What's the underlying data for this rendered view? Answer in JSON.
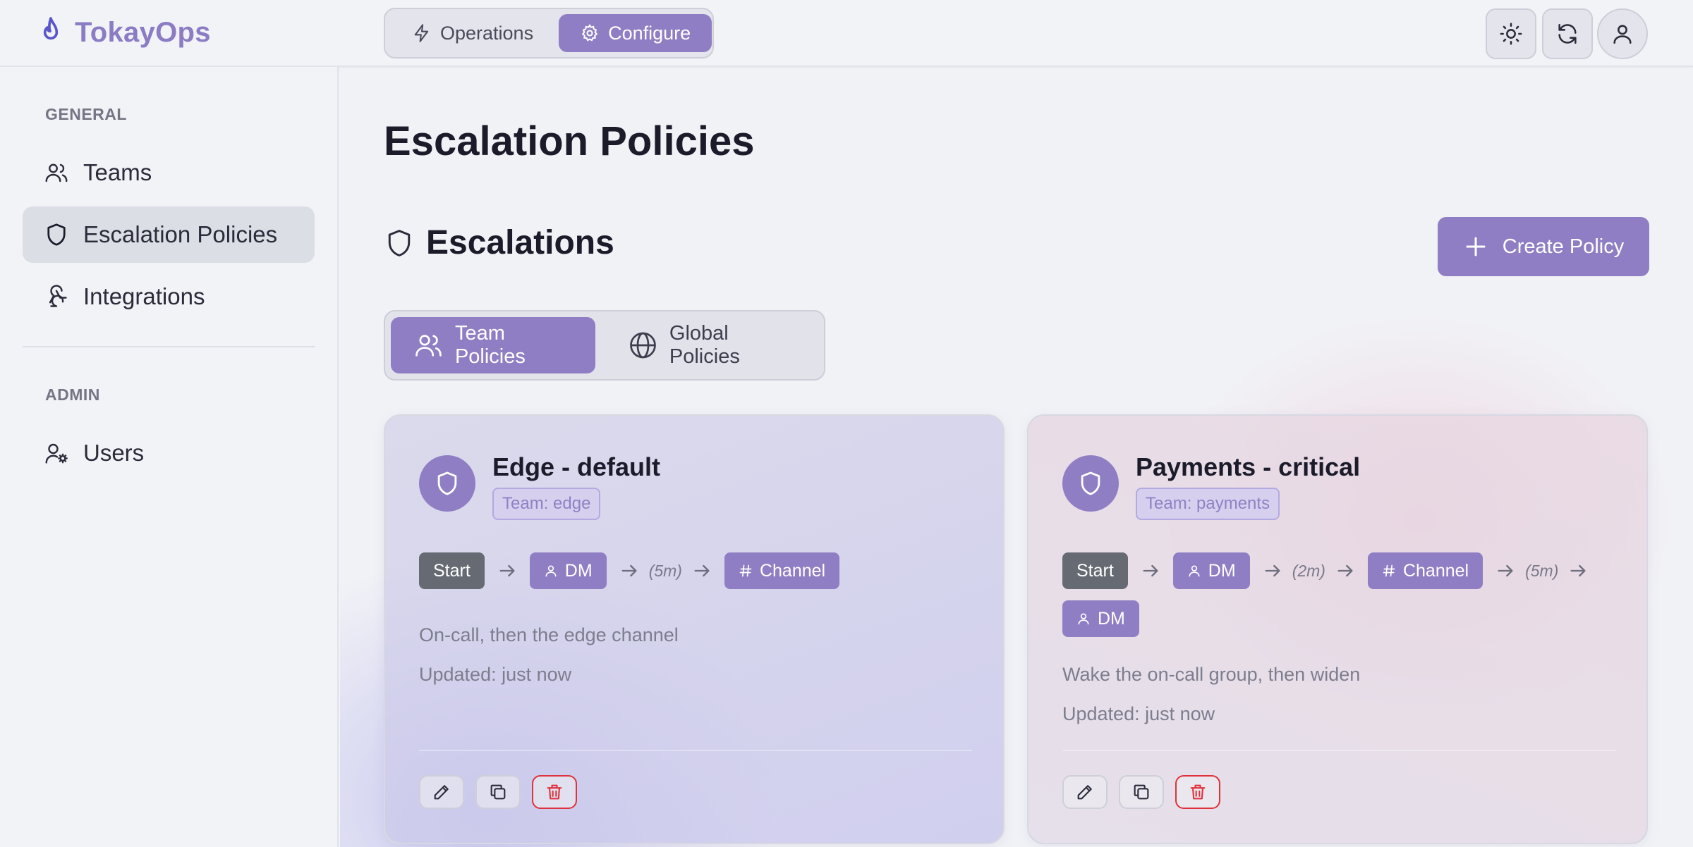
{
  "brand": {
    "name": "TokayOps"
  },
  "header": {
    "modes": [
      {
        "label": "Operations",
        "icon": "lightning-icon",
        "active": false
      },
      {
        "label": "Configure",
        "icon": "gear-icon",
        "active": true
      }
    ],
    "actions": [
      "sun-icon",
      "refresh-icon",
      "user-icon"
    ]
  },
  "sidebar": {
    "sections": [
      {
        "label": "GENERAL",
        "items": [
          {
            "label": "Teams",
            "icon": "users-icon"
          },
          {
            "label": "Escalation Policies",
            "icon": "shield-icon",
            "active": true
          },
          {
            "label": "Integrations",
            "icon": "webhook-icon"
          }
        ]
      },
      {
        "label": "ADMIN",
        "items": [
          {
            "label": "Users",
            "icon": "user-cog-icon"
          }
        ]
      }
    ]
  },
  "main": {
    "page_title": "Escalation Policies",
    "section_title": "Escalations",
    "create_label": "Create Policy",
    "scope_tabs": [
      {
        "label": "Team Policies",
        "icon": "users-icon",
        "active": true
      },
      {
        "label": "Global Policies",
        "icon": "globe-icon",
        "active": false
      }
    ]
  },
  "policies": [
    {
      "title": "Edge - default",
      "team": "Team: edge",
      "flow": {
        "start": "Start",
        "steps": [
          {
            "label": "DM",
            "icon": "user-icon"
          },
          {
            "delay": "(5m)"
          },
          {
            "label": "Channel",
            "icon": "hash-icon"
          }
        ]
      },
      "description": "On-call, then the edge channel",
      "updated": "Updated: just now"
    },
    {
      "title": "Payments - critical",
      "team": "Team: payments",
      "flow": {
        "start": "Start",
        "steps": [
          {
            "label": "DM",
            "icon": "user-icon"
          },
          {
            "delay": "(2m)"
          },
          {
            "label": "Channel",
            "icon": "hash-icon"
          },
          {
            "delay": "(5m)"
          },
          {
            "label": "DM",
            "icon": "user-icon"
          }
        ]
      },
      "description": "Wake the on-call group, then widen",
      "updated": "Updated: just now"
    }
  ],
  "colors": {
    "accent": "#8f7ec4",
    "start_chip": "#666a72",
    "danger": "#e0323c"
  }
}
